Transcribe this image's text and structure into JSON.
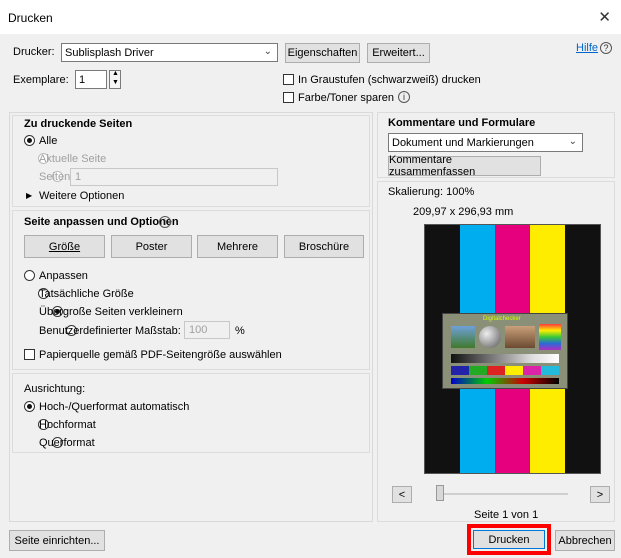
{
  "window": {
    "title": "Drucken",
    "close_glyph": "✕"
  },
  "printer": {
    "label": "Drucker:",
    "selected": "Sublisplash Driver",
    "properties_button": "Eigenschaften",
    "advanced_button": "Erweitert...",
    "help_link": "Hilfe",
    "copies_label": "Exemplare:",
    "copies_value": "1",
    "grayscale_label": "In Graustufen (schwarzweiß) drucken",
    "save_toner_label": "Farbe/Toner sparen"
  },
  "pages_to_print": {
    "heading": "Zu druckende Seiten",
    "all": "Alle",
    "current": "Aktuelle Seite",
    "pages": "Seiten",
    "pages_value": "1",
    "more_options": "Weitere Optionen"
  },
  "page_sizing": {
    "heading": "Seite anpassen und Optionen",
    "buttons": [
      "Größe",
      "Poster",
      "Mehrere",
      "Broschüre"
    ],
    "fit": "Anpassen",
    "actual_size": "Tatsächliche Größe",
    "shrink": "Übergroße Seiten verkleinern",
    "custom_scale": "Benutzerdefinierter Maßstab:",
    "custom_scale_value": "100",
    "percent": "%",
    "paper_source": "Papierquelle gemäß PDF-Seitengröße auswählen"
  },
  "orientation": {
    "heading": "Ausrichtung:",
    "auto": "Hoch-/Querformat automatisch",
    "portrait": "Hochformat",
    "landscape": "Querformat"
  },
  "comments": {
    "heading": "Kommentare und Formulare",
    "selected": "Dokument und Markierungen",
    "summarize_button": "Kommentare zusammenfassen"
  },
  "preview": {
    "scaling": "Skalierung: 100%",
    "dimensions": "209,97 x 296,93 mm",
    "test_chart_title": "Digitalchecker",
    "page_indicator": "Seite 1 von 1",
    "stripe_colors": [
      "#111111",
      "#00aeef",
      "#e6007e",
      "#ffed00",
      "#111111"
    ]
  },
  "footer": {
    "page_setup_button": "Seite einrichten...",
    "print_button": "Drucken",
    "cancel_button": "Abbrechen"
  }
}
